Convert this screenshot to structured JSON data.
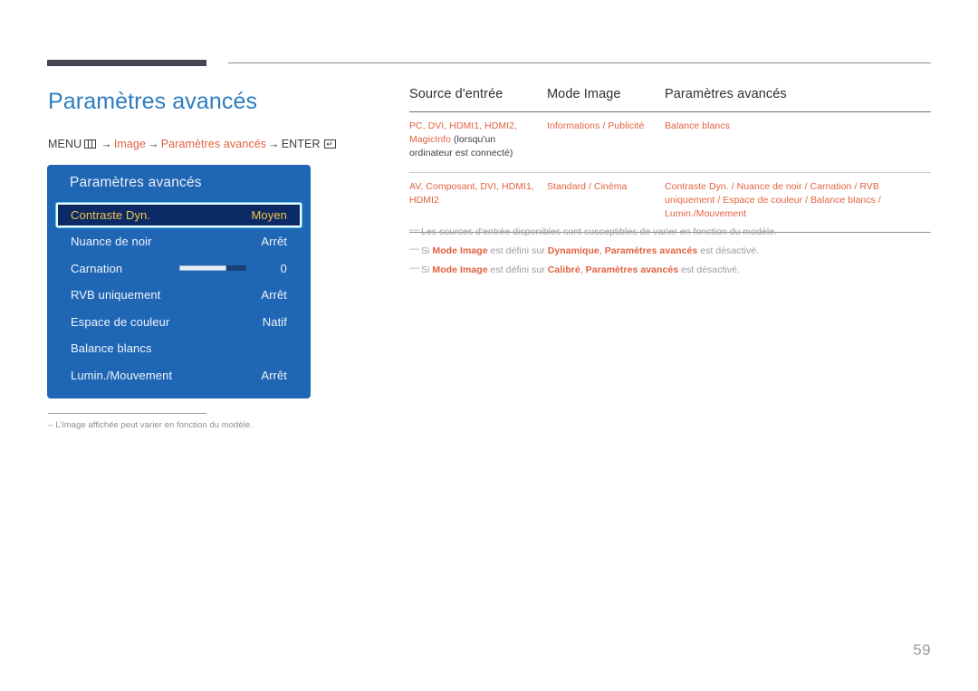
{
  "header": {
    "title": "Paramètres avancés",
    "breadcrumb": {
      "menu_label": "MENU",
      "menu_icon": "menu-grid-icon",
      "arrow": "→",
      "step1": "Image",
      "step2": "Paramètres avancés",
      "enter_label": "ENTER",
      "enter_icon": "enter-key-icon"
    }
  },
  "osd": {
    "title": "Paramètres avancés",
    "rows": [
      {
        "label": "Contraste Dyn.",
        "value": "Moyen",
        "selected": true,
        "type": "option"
      },
      {
        "label": "Nuance de noir",
        "value": "Arrêt",
        "selected": false,
        "type": "option"
      },
      {
        "label": "Carnation",
        "value": "0",
        "selected": false,
        "type": "slider",
        "slider_percent": 70
      },
      {
        "label": "RVB uniquement",
        "value": "Arrêt",
        "selected": false,
        "type": "option"
      },
      {
        "label": "Espace de couleur",
        "value": "Natif",
        "selected": false,
        "type": "option"
      },
      {
        "label": "Balance blancs",
        "value": "",
        "selected": false,
        "type": "submenu"
      },
      {
        "label": "Lumin./Mouvement",
        "value": "Arrêt",
        "selected": false,
        "type": "option"
      }
    ]
  },
  "left_note": {
    "dash": "–",
    "text": "L'image affichée peut varier en fonction du modèle."
  },
  "table": {
    "headers": [
      "Source d'entrée",
      "Mode Image",
      "Paramètres avancés"
    ],
    "rows": [
      {
        "source_orange": "PC, DVI, HDMI1, HDMI2, MagicInfo",
        "source_dark": " (lorsqu'un ordinateur est connecté)",
        "mode": "Informations / Publicité",
        "advanced": "Balance blancs"
      },
      {
        "source_orange": "AV, Composant, DVI, HDMI1, HDMI2",
        "source_dark": "",
        "mode": "Standard / Cinéma",
        "advanced": "Contraste Dyn. / Nuance de noir / Carnation / RVB uniquement / Espace de couleur / Balance blancs / Lumin./Mouvement"
      }
    ]
  },
  "notes": [
    {
      "dash": "―",
      "parts": [
        {
          "text": "Les sources d'entrée disponibles sont susceptibles de varier en fonction du modèle.",
          "style": "plain"
        }
      ]
    },
    {
      "dash": "―",
      "parts": [
        {
          "text": "Si ",
          "style": "plain"
        },
        {
          "text": "Mode Image",
          "style": "bold-orange"
        },
        {
          "text": " est défini sur ",
          "style": "plain"
        },
        {
          "text": "Dynamique",
          "style": "bold-orange"
        },
        {
          "text": ", ",
          "style": "orange"
        },
        {
          "text": "Paramètres avancés",
          "style": "bold-orange"
        },
        {
          "text": " est désactivé.",
          "style": "plain"
        }
      ]
    },
    {
      "dash": "―",
      "parts": [
        {
          "text": "Si ",
          "style": "plain"
        },
        {
          "text": "Mode Image",
          "style": "bold-orange"
        },
        {
          "text": " est défini sur ",
          "style": "plain"
        },
        {
          "text": "Calibré",
          "style": "bold-orange"
        },
        {
          "text": ", ",
          "style": "orange"
        },
        {
          "text": "Paramètres avancés",
          "style": "bold-orange"
        },
        {
          "text": " est désactivé.",
          "style": "plain"
        }
      ]
    }
  ],
  "page_number": "59",
  "colors": {
    "title_blue": "#2d7cc0",
    "accent_orange": "#e2613f",
    "osd_blue": "#1f66b5",
    "osd_selected_bg": "#0c2a66",
    "osd_selected_text": "#f2c544",
    "note_gray": "#9a9aa4",
    "rule_dark": "#474554"
  }
}
